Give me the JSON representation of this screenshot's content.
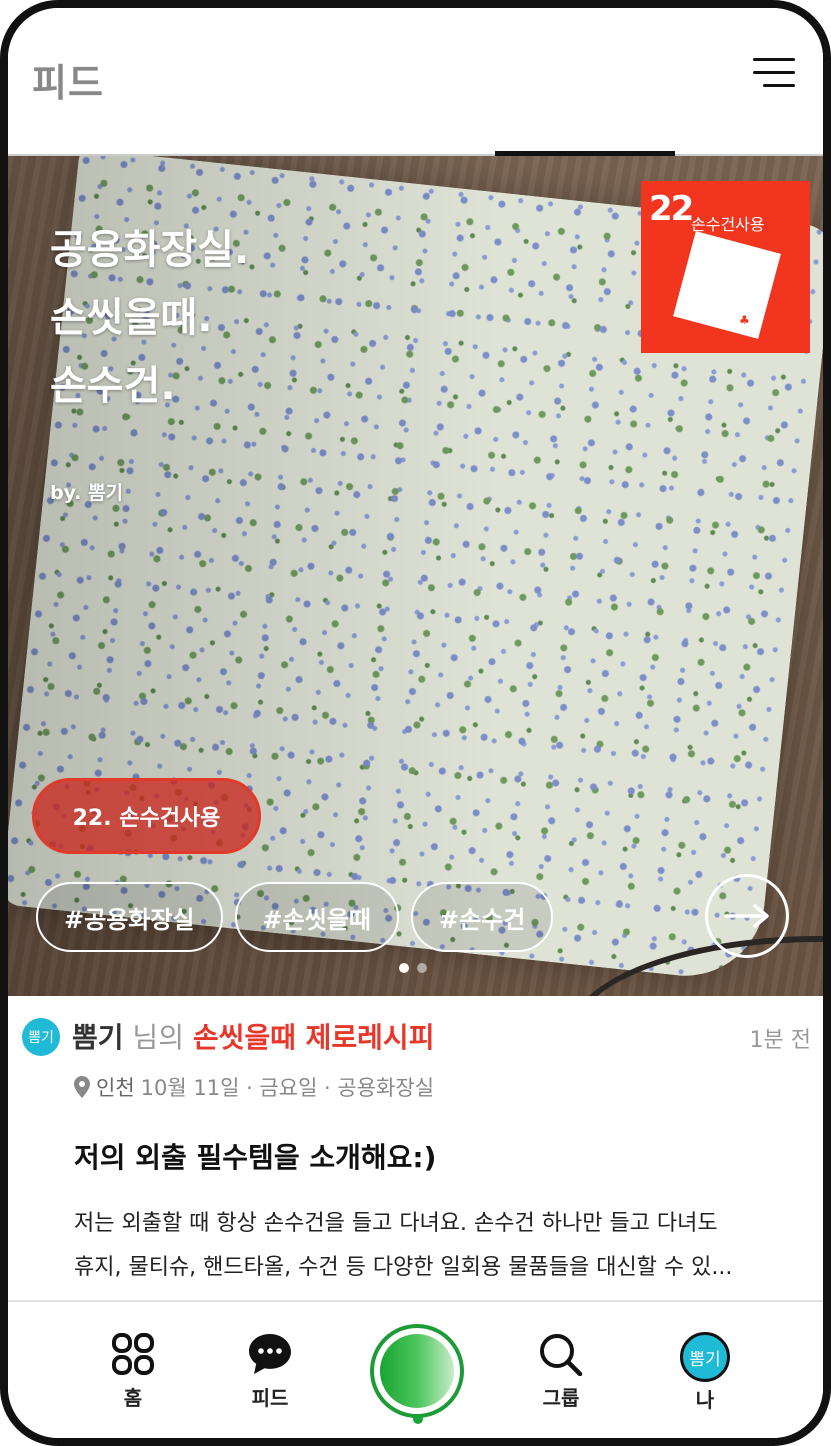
{
  "header": {
    "title": "피드"
  },
  "hero": {
    "title": "공용화장실.\n손씻을때.\n손수건.",
    "author": "by. 뽐기",
    "badge": {
      "number": "22",
      "label": "손수건사용"
    },
    "challenge_chip": "22. 손수건사용",
    "tags": [
      "#공용화장실",
      "#손씻을때",
      "#손수건"
    ],
    "carousel": {
      "total": 2,
      "active": 1
    }
  },
  "post": {
    "avatar_text": "뽐기",
    "author": "뽐기",
    "author_suffix": " 님의 ",
    "recipe": "손씻을때 제로레시피",
    "time": "1분 전",
    "city": "인천",
    "meta": "10월 11일 · 금요일 · 공용화장실",
    "title": "저의 외출 필수템을 소개해요:)",
    "body_line1": "저는 외출할 때 항상 손수건을 들고 다녀요. 손수건 하나만 들고 다녀도",
    "body_line2": "휴지, 물티슈, 핸드타올, 수건 등 다양한 일회용 물품들을 대신할 수 있..."
  },
  "nav": {
    "home": "홈",
    "feed": "피드",
    "group": "그룹",
    "me": "나",
    "me_avatar": "뽐기"
  },
  "colors": {
    "accent_red": "#e8372a",
    "badge_red": "#f2351e",
    "brand_green": "#19a534",
    "avatar_cyan": "#1fbad6"
  }
}
